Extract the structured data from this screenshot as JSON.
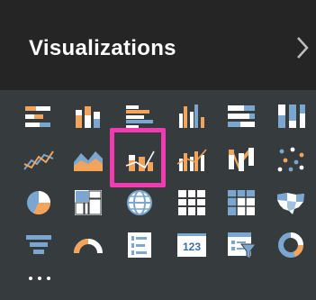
{
  "pane": {
    "title": "Visualizations",
    "collapse_icon": "chevron-right-icon",
    "more_icon": "ellipsis-icon"
  },
  "visuals": [
    [
      "stacked-bar-chart-icon",
      "stacked-column-chart-icon",
      "clustered-bar-chart-icon",
      "clustered-column-chart-icon",
      "100-percent-stacked-bar-chart-icon",
      "100-percent-stacked-column-chart-icon"
    ],
    [
      "line-chart-icon",
      "area-chart-icon",
      "line-and-stacked-column-chart-icon",
      "line-and-clustered-column-chart-icon",
      "ribbon-chart-icon",
      "scatter-chart-icon"
    ],
    [
      "pie-chart-icon",
      "treemap-icon",
      "map-icon",
      "table-icon",
      "matrix-icon",
      "filled-map-icon"
    ],
    [
      "funnel-icon",
      "gauge-icon",
      "multi-row-card-icon",
      "card-icon",
      "slicer-icon",
      "donut-chart-icon"
    ]
  ],
  "card_text": "123",
  "selected_visual": "line-and-stacked-column-chart-icon",
  "colors": {
    "header_bg": "#252526",
    "panel_bg": "#363b3e",
    "orange": "#f2a45c",
    "blue": "#7ba6cf",
    "white": "#ffffff",
    "highlight": "#f03cb0"
  }
}
